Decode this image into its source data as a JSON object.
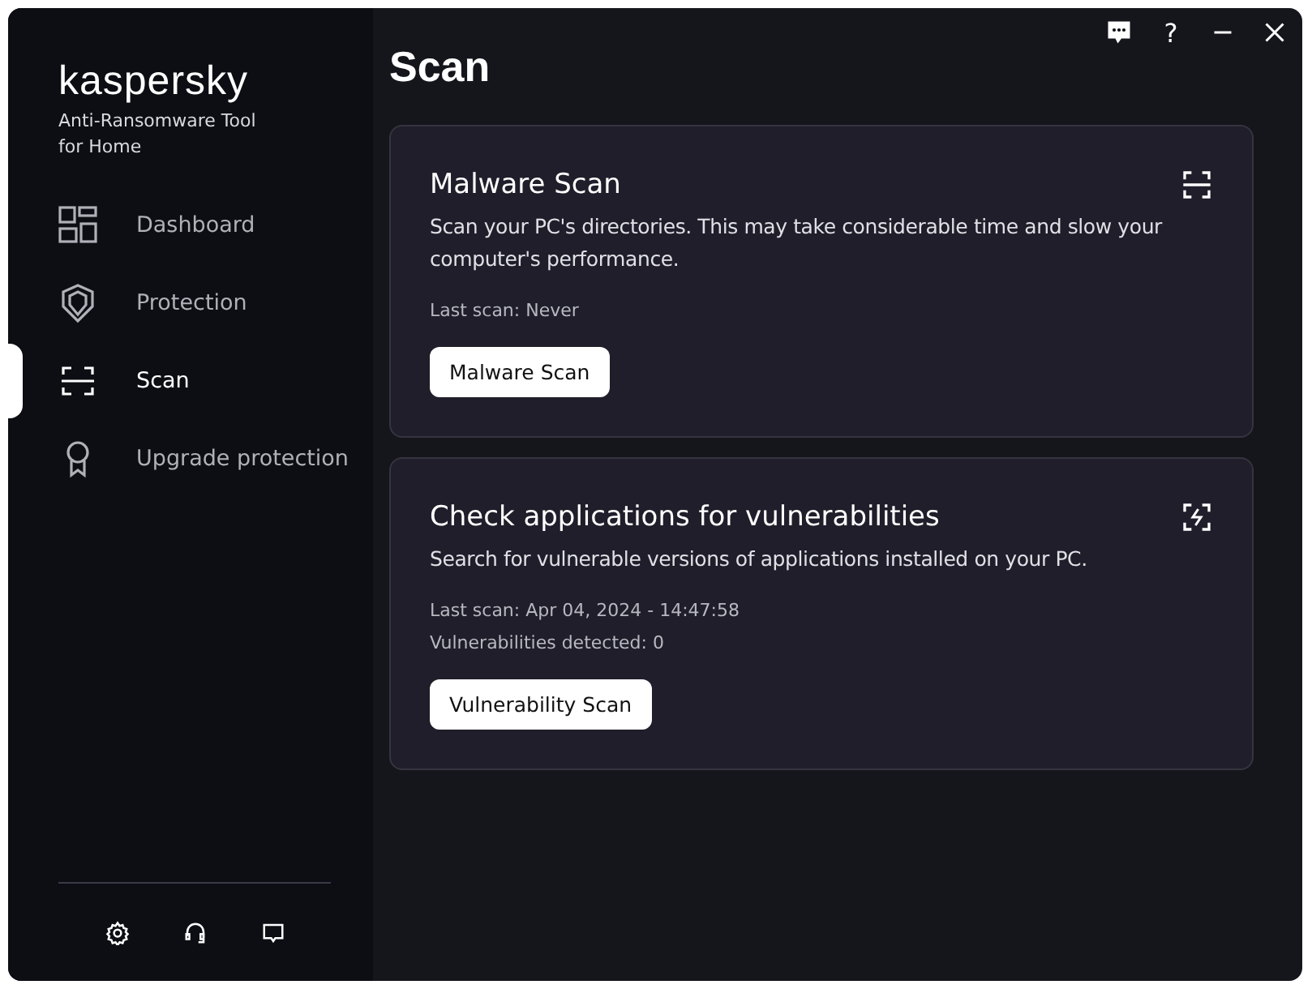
{
  "brand": {
    "logo": "kaspersky",
    "subtitle": "Anti-Ransomware Tool\nfor Home"
  },
  "sidebar": {
    "items": [
      {
        "label": "Dashboard",
        "kind": "dashboard",
        "selected": false
      },
      {
        "label": "Protection",
        "kind": "shield",
        "selected": false
      },
      {
        "label": "Scan",
        "kind": "scan",
        "selected": true
      },
      {
        "label": "Upgrade protection",
        "kind": "award",
        "selected": false
      }
    ]
  },
  "title_bar": {
    "help_label": "?"
  },
  "page_title": "Scan",
  "cards": [
    {
      "title": "Malware Scan",
      "description": "Scan your PC's directories. This may take considerable time and slow your computer's performance.",
      "details": [
        "Last scan: Never"
      ],
      "button": "Malware Scan"
    },
    {
      "title": "Check applications for vulnerabilities",
      "description": "Search for vulnerable versions of applications installed on your PC.",
      "details": [
        "Last scan: Apr 04, 2024 - 14:47:58",
        "Vulnerabilities detected: 0"
      ],
      "button": "Vulnerability Scan"
    }
  ]
}
